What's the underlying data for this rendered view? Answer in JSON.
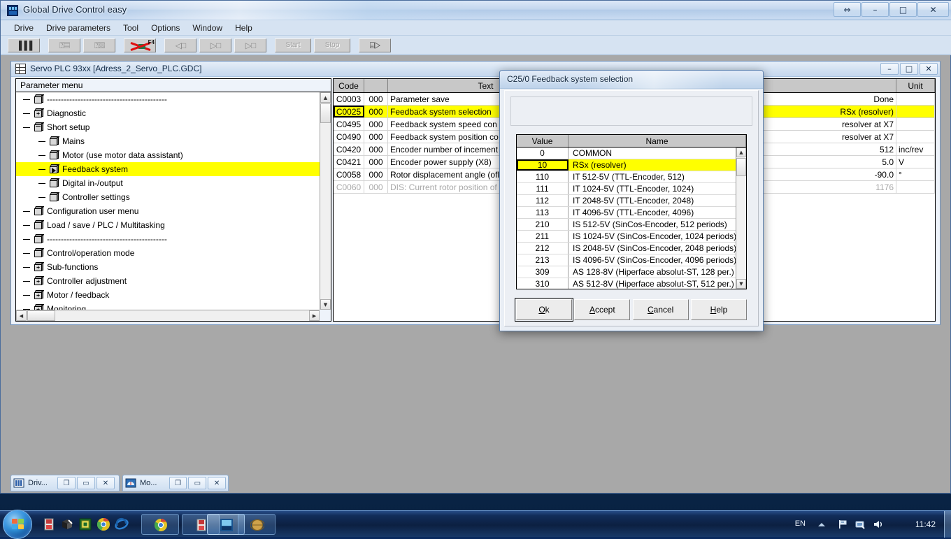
{
  "app": {
    "title": "Global Drive Control easy",
    "icon": "app-icon",
    "caption_buttons": [
      {
        "name": "restore-down-button",
        "glyph": "⇔"
      },
      {
        "name": "minimize-button",
        "glyph": "–"
      },
      {
        "name": "maximize-button",
        "glyph": "□"
      },
      {
        "name": "close-button",
        "glyph": "✕"
      }
    ]
  },
  "menubar": {
    "items": [
      {
        "label": "Drive"
      },
      {
        "label": "Drive parameters"
      },
      {
        "label": "Tool"
      },
      {
        "label": "Options"
      },
      {
        "label": "Window"
      },
      {
        "label": "Help"
      }
    ]
  },
  "toolbar": {
    "buttons": [
      {
        "name": "parameter-list-button",
        "kind": "glyph",
        "glyph": "▐▐▐",
        "label": "",
        "badge": "",
        "enabled": true
      },
      {
        "name": "diagnostics-button",
        "kind": "glyph",
        "glyph": "⍰▤",
        "label": "",
        "badge": "",
        "enabled": false
      },
      {
        "name": "help-context-button",
        "kind": "glyph",
        "glyph": "⍰▧",
        "label": "",
        "badge": "",
        "enabled": false
      },
      {
        "name": "disconnect-button",
        "kind": "redx",
        "glyph": "",
        "label": "",
        "badge": "F4",
        "enabled": true
      },
      {
        "name": "upload-button",
        "kind": "glyph",
        "glyph": "◁□",
        "label": "",
        "badge": "",
        "enabled": false
      },
      {
        "name": "download-button",
        "kind": "glyph",
        "glyph": "▷□",
        "label": "",
        "badge": "",
        "enabled": false
      },
      {
        "name": "download-all-button",
        "kind": "glyph",
        "glyph": "▷□",
        "label": "",
        "badge": "",
        "enabled": false
      },
      {
        "name": "start-button",
        "kind": "text",
        "glyph": "",
        "label": "Start",
        "badge": "",
        "enabled": false
      },
      {
        "name": "stop-button",
        "kind": "text",
        "glyph": "",
        "label": "Stop",
        "badge": "",
        "enabled": false
      },
      {
        "name": "motor-button",
        "kind": "glyph",
        "glyph": "⌸▷",
        "label": "",
        "badge": "",
        "enabled": true
      }
    ]
  },
  "mdi_window": {
    "title": "Servo PLC 93xx [Adress_2_Servo_PLC.GDC]",
    "caption_buttons": [
      {
        "name": "mdi-minimize-button",
        "glyph": "–"
      },
      {
        "name": "mdi-maximize-button",
        "glyph": "□"
      },
      {
        "name": "mdi-close-button",
        "glyph": "✕"
      }
    ]
  },
  "tree": {
    "header": "Parameter menu",
    "nodes": [
      {
        "label": "-------------------------------------------",
        "depth": 0,
        "icon": "box-plain",
        "selected": false
      },
      {
        "label": "Diagnostic",
        "depth": 0,
        "icon": "box-plus",
        "selected": false
      },
      {
        "label": "Short setup",
        "depth": 0,
        "icon": "box-minus",
        "selected": false
      },
      {
        "label": "Mains",
        "depth": 1,
        "icon": "box-plain",
        "selected": false
      },
      {
        "label": "Motor  (use motor data assistant)",
        "depth": 1,
        "icon": "box-plain",
        "selected": false
      },
      {
        "label": "Feedback system",
        "depth": 1,
        "icon": "box-arrow",
        "selected": true
      },
      {
        "label": "Digital in-/output",
        "depth": 1,
        "icon": "box-plain",
        "selected": false
      },
      {
        "label": "Controller settings",
        "depth": 1,
        "icon": "box-plain",
        "selected": false
      },
      {
        "label": "Configuration user menu",
        "depth": 0,
        "icon": "box-plain",
        "selected": false
      },
      {
        "label": "Load / save / PLC / Multitasking",
        "depth": 0,
        "icon": "box-plain",
        "selected": false
      },
      {
        "label": "-------------------------------------------",
        "depth": 0,
        "icon": "box-plain",
        "selected": false
      },
      {
        "label": "Control/operation mode",
        "depth": 0,
        "icon": "box-plain",
        "selected": false
      },
      {
        "label": "Sub-functions",
        "depth": 0,
        "icon": "box-plus",
        "selected": false
      },
      {
        "label": "Controller adjustment",
        "depth": 0,
        "icon": "box-plus",
        "selected": false
      },
      {
        "label": "Motor / feedback",
        "depth": 0,
        "icon": "box-plus",
        "selected": false
      },
      {
        "label": "Monitoring",
        "depth": 0,
        "icon": "box-plus",
        "selected": false
      }
    ]
  },
  "param_table": {
    "columns": [
      "Code",
      "",
      "Text",
      "",
      "",
      "Unit"
    ],
    "rows": [
      {
        "code": "C0003",
        "sub": "000",
        "text": "Parameter save",
        "value": "Done",
        "unit": "",
        "selected": false,
        "dim": false
      },
      {
        "code": "C0025",
        "sub": "000",
        "text": "Feedback system selection",
        "value": "RSx  (resolver)",
        "unit": "",
        "selected": true,
        "dim": false
      },
      {
        "code": "C0495",
        "sub": "000",
        "text": "Feedback system speed con",
        "value": "resolver at X7",
        "unit": "",
        "selected": false,
        "dim": false
      },
      {
        "code": "C0490",
        "sub": "000",
        "text": "Feedback system position co",
        "value": "resolver at X7",
        "unit": "",
        "selected": false,
        "dim": false
      },
      {
        "code": "C0420",
        "sub": "000",
        "text": "Encoder number of incement",
        "value": "512",
        "unit": "inc/rev",
        "selected": false,
        "dim": false
      },
      {
        "code": "C0421",
        "sub": "000",
        "text": "Encoder power supply (X8)",
        "value": "5.0",
        "unit": "V",
        "selected": false,
        "dim": false
      },
      {
        "code": "C0058",
        "sub": "000",
        "text": "Rotor displacement angle (ofl",
        "value": "-90.0",
        "unit": "°",
        "selected": false,
        "dim": false
      },
      {
        "code": "C0060",
        "sub": "000",
        "text": "DIS: Current rotor position of",
        "value": "1176",
        "unit": "",
        "selected": false,
        "dim": true
      }
    ]
  },
  "dialog": {
    "title": "C25/0 Feedback system selection",
    "list": {
      "columns": {
        "value": "Value",
        "name": "Name"
      },
      "rows": [
        {
          "value": "0",
          "name": "COMMON",
          "selected": false
        },
        {
          "value": "10",
          "name": "RSx  (resolver)",
          "selected": true
        },
        {
          "value": "110",
          "name": "IT   512-5V  (TTL-Encoder, 512)",
          "selected": false
        },
        {
          "value": "111",
          "name": "IT 1024-5V  (TTL-Encoder, 1024)",
          "selected": false
        },
        {
          "value": "112",
          "name": "IT 2048-5V  (TTL-Encoder, 2048)",
          "selected": false
        },
        {
          "value": "113",
          "name": "IT 4096-5V  (TTL-Encoder, 4096)",
          "selected": false
        },
        {
          "value": "210",
          "name": "IS   512-5V  (SinCos-Encoder,   512 periods)",
          "selected": false
        },
        {
          "value": "211",
          "name": "IS 1024-5V  (SinCos-Encoder, 1024 periods)",
          "selected": false
        },
        {
          "value": "212",
          "name": "IS 2048-5V  (SinCos-Encoder, 2048 periods)",
          "selected": false
        },
        {
          "value": "213",
          "name": "IS 4096-5V  (SinCos-Encoder, 4096 periods)",
          "selected": false
        },
        {
          "value": "309",
          "name": "AS   128-8V  (Hiperface absolut-ST,   128 per.)",
          "selected": false
        },
        {
          "value": "310",
          "name": "AS   512-8V  (Hiperface absolut-ST,   512 per.)",
          "selected": false
        }
      ]
    },
    "buttons": [
      {
        "name": "ok-button",
        "pre": "",
        "key": "O",
        "post": "k",
        "default": true
      },
      {
        "name": "accept-button",
        "pre": "",
        "key": "A",
        "post": "ccept",
        "default": false
      },
      {
        "name": "cancel-button",
        "pre": "",
        "key": "C",
        "post": "ancel",
        "default": false
      },
      {
        "name": "help-button",
        "pre": "",
        "key": "H",
        "post": "elp",
        "default": false
      }
    ]
  },
  "mdi_taskbar": {
    "windows": [
      {
        "label": "Driv...",
        "icon": "drive-window-icon",
        "buttons": [
          "❐",
          "▭",
          "✕"
        ]
      },
      {
        "label": "Mo...",
        "icon": "monitor-window-icon",
        "buttons": [
          "❐",
          "▭",
          "✕"
        ]
      }
    ]
  },
  "taskbar": {
    "start_tooltip": "Start",
    "quick_launch": [
      "save-icon",
      "package-icon",
      "frame-icon",
      "chrome-icon",
      "ie-icon"
    ],
    "tasks": [
      {
        "name": "task-chrome",
        "icon": "chrome-icon",
        "active": false
      },
      {
        "name": "task-save",
        "icon": "save-icon",
        "active": false
      },
      {
        "name": "task-gdc",
        "icon": "gdc-icon",
        "active": true
      },
      {
        "name": "task-globe",
        "icon": "globe-icon",
        "active": false
      }
    ],
    "tray": {
      "language": "EN",
      "icons": [
        "show-hidden-icon",
        "network-icon",
        "action-center-icon",
        "volume-icon"
      ],
      "clock": "11:42"
    }
  },
  "colors": {
    "highlight_yellow": "#ffff00",
    "titlebar_blue": "#c3d6ee",
    "desktop_blue": "#0d2d5c",
    "mdi_gray": "#a8a8a8"
  }
}
